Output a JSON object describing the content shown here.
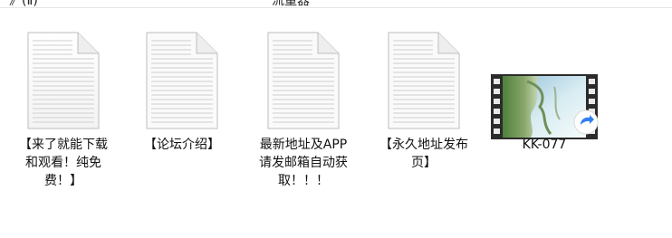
{
  "top_strip": {
    "left_text": "》(Ⅱ)",
    "center_text": "流量器"
  },
  "items": [
    {
      "name": "【来了就能下载和观看！纯免费！】",
      "type": "document",
      "icon": "document-icon"
    },
    {
      "name": "【论坛介绍】",
      "type": "document",
      "icon": "document-icon"
    },
    {
      "name": "最新地址及APP请发邮箱自动获取！！！",
      "type": "document",
      "icon": "document-icon"
    },
    {
      "name": "【永久地址发布页】",
      "type": "document",
      "icon": "document-icon"
    },
    {
      "name": "KK-077",
      "type": "video",
      "icon": "video-thumbnail-icon",
      "overlay_icon": "shortcut-arrow-icon"
    }
  ]
}
